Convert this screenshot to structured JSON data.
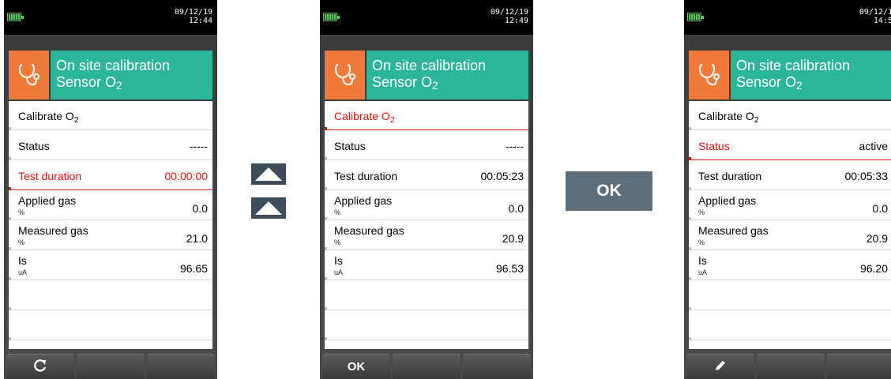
{
  "screens": [
    {
      "date": "09/12/19",
      "time": "12:44",
      "header": {
        "line1": "On site calibration",
        "line2": "Sensor O",
        "sub": "2"
      },
      "rows": {
        "calibrate": {
          "label": "Calibrate O",
          "sub": "2"
        },
        "status": {
          "label": "Status",
          "value": "-----"
        },
        "test_duration": {
          "label": "Test duration",
          "value": "00:00:00"
        },
        "applied_gas": {
          "label": "Applied gas",
          "unit": "%",
          "value": "0.0"
        },
        "measured_gas": {
          "label": "Measured gas",
          "unit": "%",
          "value": "21.0"
        },
        "is": {
          "label": "Is",
          "unit": "uA",
          "value": "96.65"
        }
      },
      "selected_row": "test_duration",
      "softkeys": [
        "refresh-icon",
        "",
        ""
      ]
    },
    {
      "date": "09/12/19",
      "time": "12:49",
      "header": {
        "line1": "On site calibration",
        "line2": "Sensor O",
        "sub": "2"
      },
      "rows": {
        "calibrate": {
          "label": "Calibrate O",
          "sub": "2"
        },
        "status": {
          "label": "Status",
          "value": "-----"
        },
        "test_duration": {
          "label": "Test duration",
          "value": "00:05:23"
        },
        "applied_gas": {
          "label": "Applied gas",
          "unit": "%",
          "value": "0.0"
        },
        "measured_gas": {
          "label": "Measured gas",
          "unit": "%",
          "value": "20.9"
        },
        "is": {
          "label": "Is",
          "unit": "uA",
          "value": "96.53"
        }
      },
      "selected_row": "calibrate",
      "softkeys": [
        "OK",
        "",
        ""
      ]
    },
    {
      "date": "09/12/1",
      "time": "14:5",
      "header": {
        "line1": "On site calibration",
        "line2": "Sensor O",
        "sub": "2"
      },
      "rows": {
        "calibrate": {
          "label": "Calibrate O",
          "sub": "2"
        },
        "status": {
          "label": "Status",
          "value": "active"
        },
        "test_duration": {
          "label": "Test duration",
          "value": "00:05:33"
        },
        "applied_gas": {
          "label": "Applied gas",
          "unit": "%",
          "value": "0.0"
        },
        "measured_gas": {
          "label": "Measured gas",
          "unit": "%",
          "value": "20.9"
        },
        "is": {
          "label": "Is",
          "unit": "uA",
          "value": "96.20"
        }
      },
      "selected_row": "status",
      "softkeys": [
        "pencil-icon",
        "",
        ""
      ]
    }
  ],
  "keys": {
    "up_arrow_icon": "up-arrow-icon",
    "ok_label": "OK"
  },
  "colors": {
    "header_icon_bg": "#f07a3a",
    "header_title_bg": "#2bb59a",
    "selected_text": "#e01010"
  }
}
